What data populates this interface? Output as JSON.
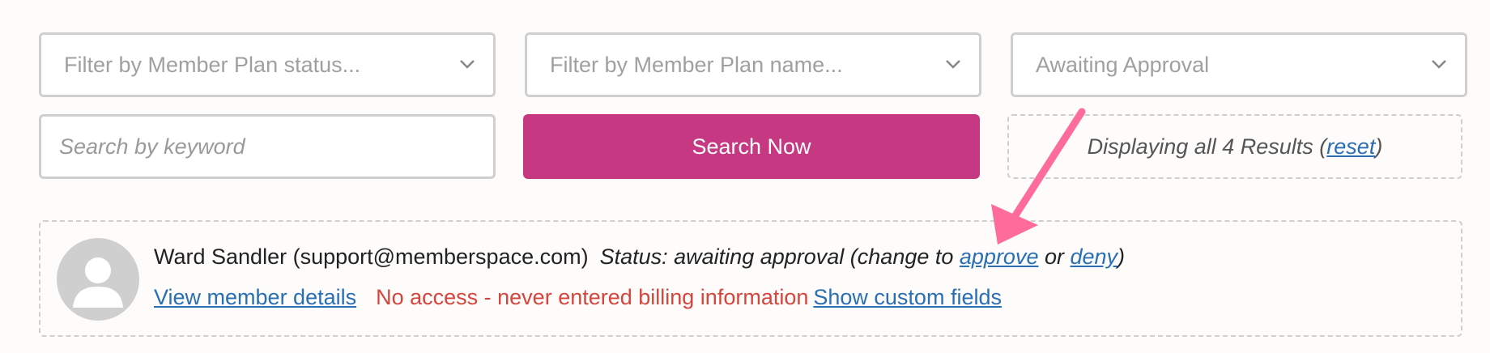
{
  "filters": {
    "plan_status": {
      "value": "Filter by Member Plan status...",
      "icon": "chevron-down-icon"
    },
    "plan_name": {
      "value": "Filter by Member Plan name...",
      "icon": "chevron-down-icon"
    },
    "approval": {
      "value": "Awaiting Approval",
      "icon": "chevron-down-icon"
    }
  },
  "search": {
    "placeholder": "Search by keyword",
    "button_label": "Search Now"
  },
  "results": {
    "prefix": "Displaying all 4 Results (",
    "reset_label": "reset",
    "suffix": ")"
  },
  "member": {
    "name_email": "Ward Sandler (support@memberspace.com)",
    "status_prefix": "Status: awaiting approval (change to ",
    "approve_label": "approve",
    "or_text": " or ",
    "deny_label": "deny",
    "status_suffix": ")",
    "view_details_label": "View member details",
    "access_text": "No access - never entered billing information",
    "custom_fields_label": "Show custom fields",
    "avatar_icon": "user-avatar-icon"
  },
  "colors": {
    "accent": "#c63882",
    "link": "#2a6fb4",
    "warning": "#d6453c",
    "annotation_arrow": "#ff6b9a"
  }
}
